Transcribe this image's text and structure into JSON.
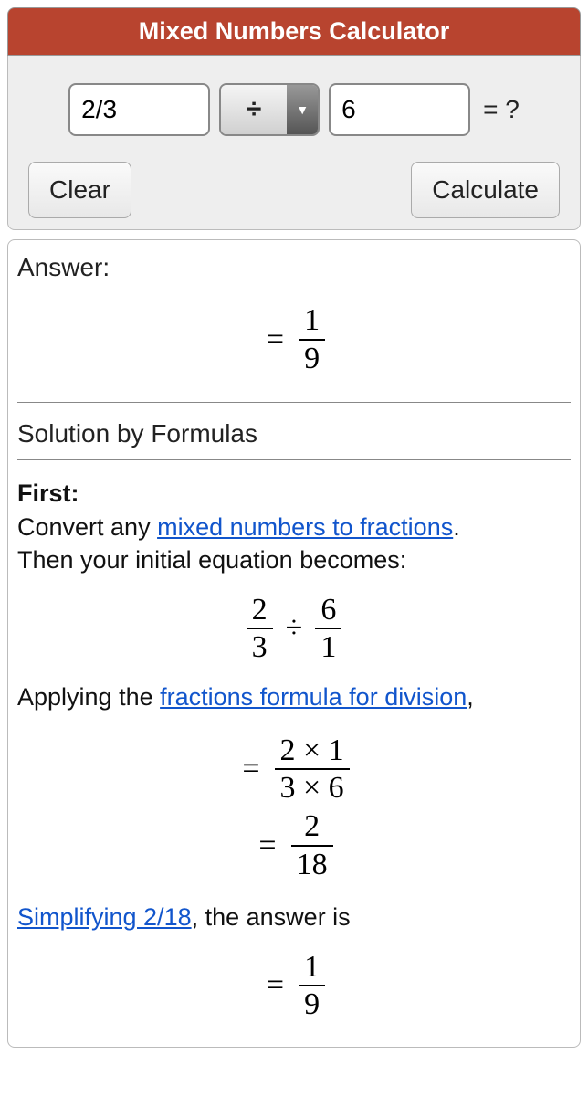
{
  "header": {
    "title": "Mixed Numbers Calculator"
  },
  "inputs": {
    "operand1": "2/3",
    "operator": "÷",
    "operand2": "6",
    "equals_label": "= ?"
  },
  "buttons": {
    "clear": "Clear",
    "calculate": "Calculate"
  },
  "answer": {
    "label": "Answer:",
    "equals": "=",
    "frac_num": "1",
    "frac_den": "9"
  },
  "solution": {
    "heading": "Solution by Formulas",
    "first_label": "First:",
    "convert_pre": "Convert any ",
    "convert_link": "mixed numbers to fractions",
    "convert_post": ".",
    "then_line": "Then your initial equation becomes:",
    "eq1": {
      "a_num": "2",
      "a_den": "3",
      "op": "÷",
      "b_num": "6",
      "b_den": "1"
    },
    "apply_pre": "Applying the ",
    "apply_link": "fractions formula for division",
    "apply_post": ",",
    "eq2": {
      "equals": "=",
      "num": "2 × 1",
      "den": "3 × 6"
    },
    "eq3": {
      "equals": "=",
      "num": "2",
      "den": "18"
    },
    "simplify_link": "Simplifying 2/18",
    "simplify_post": ", the answer is",
    "eq4": {
      "equals": "=",
      "num": "1",
      "den": "9"
    }
  }
}
